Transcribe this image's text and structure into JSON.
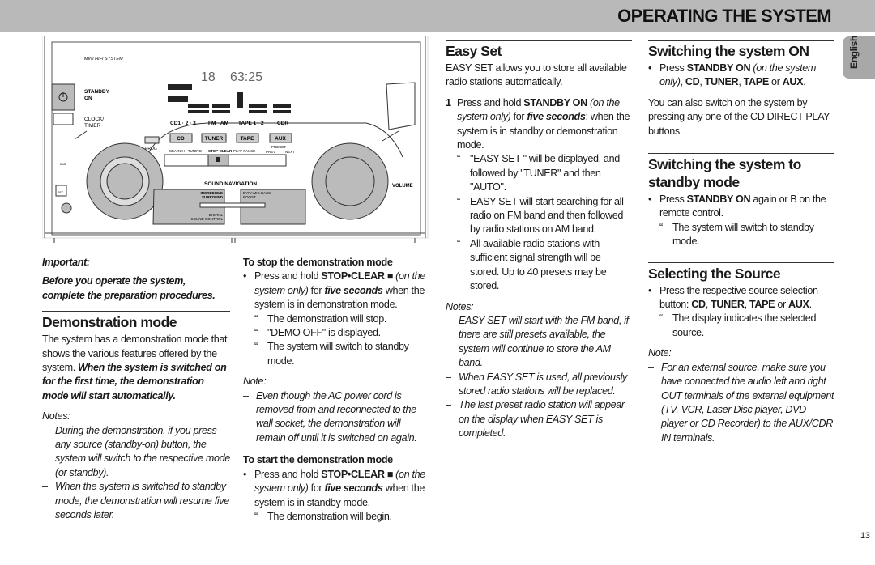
{
  "header": {
    "title": "OPERATING THE SYSTEM"
  },
  "lang_tab": "English",
  "page_number": "13",
  "device": {
    "brand": "MINI HIFI SYSTEM",
    "display_track": "18",
    "display_time": "63:25",
    "standby": "STANDBY",
    "on": "ON",
    "clock": "CLOCK/",
    "timer": "TIMER",
    "src_labels": [
      "CD1 · 2 · 3",
      "FM · AM",
      "TAPE 1 · 2",
      "CDR"
    ],
    "src_buttons": [
      "CD",
      "TUNER",
      "TAPE",
      "AUX"
    ],
    "prog": "PROG",
    "search": "SEARCH • TUNING",
    "stop": "STOP•CLEAR",
    "play": "PLAY  PAUSE",
    "prev": "PREV",
    "preset": "PRESET",
    "next": "NEXT",
    "sound_nav": "SOUND NAVIGATION",
    "incredible": "INCREDIBLE",
    "surround": "SURROUND",
    "dbb1": "DYNAMIC BASS",
    "dbb2": "BOOST",
    "dsc1": "DIGITAL",
    "dsc2": "SOUND CONTROL",
    "volume": "VOLUME",
    "rec": "REC",
    "dub": "DUB"
  },
  "col1": {
    "important": [
      [
        "Important:",
        "bi"
      ]
    ],
    "important_text": [
      [
        "Before you operate the system, complete the preparation procedures.",
        "bi"
      ]
    ],
    "heading": "Demonstration mode",
    "para": [
      [
        "The system has a demonstration mode that shows the various features offered by the system. ",
        ""
      ],
      [
        "When the system is switched on for the first time, the demonstration mode will start automatically.",
        "bi"
      ]
    ],
    "notes_label": "Notes:",
    "notes": [
      [
        [
          "During the demonstration, if you press any source (standby-on) button, the system will switch to the respective mode (or standby).",
          ""
        ]
      ],
      [
        [
          "When the system is switched to standby mode, the demonstration will resume five seconds later.",
          ""
        ]
      ]
    ]
  },
  "col2": {
    "stop_title": "To stop the demonstration mode",
    "stop_bullet": [
      [
        "Press and hold ",
        ""
      ],
      [
        "STOP•CLEAR ■",
        "b"
      ],
      [
        " (on the system only)",
        "i"
      ],
      [
        " for ",
        ""
      ],
      [
        "five seconds",
        "bi"
      ],
      [
        " when the system is in demonstration mode.",
        ""
      ]
    ],
    "stop_subs": [
      [
        [
          "The demonstration will stop.",
          ""
        ]
      ],
      [
        [
          "\"DEMO OFF\" is displayed.",
          ""
        ]
      ],
      [
        [
          "The system will switch to standby mode.",
          ""
        ]
      ]
    ],
    "note_label": "Note:",
    "note": [
      [
        "Even though the AC power cord is removed from and reconnected to the wall socket, the demonstration will remain off until it is switched on again.",
        ""
      ]
    ],
    "start_title": "To start the demonstration mode",
    "start_bullet": [
      [
        "Press and hold ",
        ""
      ],
      [
        "STOP•CLEAR ■",
        "b"
      ],
      [
        " (on the system only)",
        "i"
      ],
      [
        " for ",
        ""
      ],
      [
        "five seconds",
        "bi"
      ],
      [
        " when the system is in standby mode.",
        ""
      ]
    ],
    "start_subs": [
      [
        [
          "The demonstration will begin.",
          ""
        ]
      ]
    ]
  },
  "col3": {
    "heading": "Easy Set",
    "para": [
      [
        "EASY SET allows you to store all available radio stations automatically.",
        ""
      ]
    ],
    "step_num": "1",
    "step": [
      [
        "Press and hold ",
        ""
      ],
      [
        "STANDBY ON",
        "b"
      ],
      [
        " (on the system only)",
        "i"
      ],
      [
        " for ",
        ""
      ],
      [
        "five seconds",
        "bi"
      ],
      [
        "; when the system is in standby or demonstration mode.",
        ""
      ]
    ],
    "subs": [
      [
        [
          "\"EASY SET \" will be displayed, and followed by \"TUNER\" and then \"AUTO\".",
          ""
        ]
      ],
      [
        [
          "EASY SET will start searching for all radio on FM band and then followed by radio stations on AM band.",
          ""
        ]
      ],
      [
        [
          "All available radio stations with sufficient signal strength will be stored. Up to 40 presets may be stored.",
          ""
        ]
      ]
    ],
    "notes_label": "Notes:",
    "notes": [
      [
        [
          "EASY SET will start with the FM band, if there are still presets available, the system will continue to store the AM band.",
          ""
        ]
      ],
      [
        [
          "When EASY SET is used, all previously stored radio stations will be replaced.",
          ""
        ]
      ],
      [
        [
          "The last preset radio station will appear on the display when EASY SET is completed.",
          ""
        ]
      ]
    ]
  },
  "col4": {
    "h_on": "Switching the system ON",
    "on_bullet": [
      [
        "Press ",
        ""
      ],
      [
        "STANDBY ON",
        "b"
      ],
      [
        " (on the system only)",
        "i"
      ],
      [
        ", ",
        ""
      ],
      [
        "CD",
        "b"
      ],
      [
        ", ",
        ""
      ],
      [
        "TUNER",
        "b"
      ],
      [
        ", ",
        ""
      ],
      [
        "TAPE",
        "b"
      ],
      [
        " or ",
        ""
      ],
      [
        "AUX",
        "b"
      ],
      [
        ".",
        ""
      ]
    ],
    "on_para": [
      [
        "You can also switch on the system by pressing any one of the CD DIRECT PLAY buttons.",
        ""
      ]
    ],
    "h_standby": "Switching the system to standby mode",
    "standby_bullet": [
      [
        "Press ",
        ""
      ],
      [
        "STANDBY ON",
        "b"
      ],
      [
        " again or B  on the remote control.",
        ""
      ]
    ],
    "standby_sub": [
      [
        "The system will switch to standby mode.",
        ""
      ]
    ],
    "h_source": "Selecting the Source",
    "source_bullet": [
      [
        "Press the respective source selection button: ",
        ""
      ],
      [
        "CD",
        "b"
      ],
      [
        ", ",
        ""
      ],
      [
        "TUNER",
        "b"
      ],
      [
        ", ",
        ""
      ],
      [
        "TAPE",
        "b"
      ],
      [
        " or ",
        ""
      ],
      [
        "AUX",
        "b"
      ],
      [
        ".",
        ""
      ]
    ],
    "source_sub": [
      [
        "The display indicates the selected source.",
        ""
      ]
    ],
    "note_label": "Note:",
    "note": [
      [
        "For an external source, make sure you have connected the audio left and right OUT terminals of the external equipment (TV, VCR, Laser Disc player, DVD player or CD Recorder) to the AUX/CDR IN terminals.",
        ""
      ]
    ]
  },
  "markers": {
    "bullet": "•",
    "sub": "“",
    "dash": "–"
  }
}
